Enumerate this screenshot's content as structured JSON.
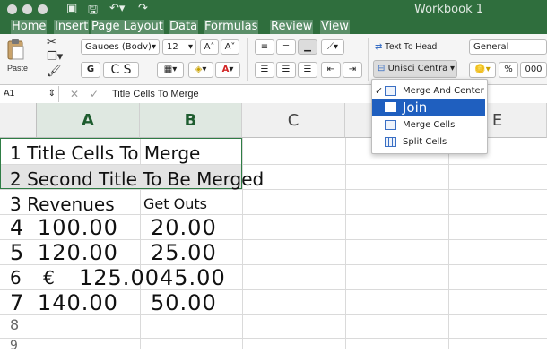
{
  "window": {
    "title": "Workbook 1",
    "controls": [
      "close-icon",
      "minimize-icon",
      "zoom-icon"
    ]
  },
  "quick_access": [
    "sidebar-icon",
    "save-icon",
    "undo-icon",
    "redo-icon"
  ],
  "menu": {
    "tabs": [
      "Home",
      "Insert",
      "Page Layout",
      "Data",
      "Formulas",
      "Review",
      "View"
    ]
  },
  "ribbon": {
    "paste_label": "Paste",
    "font_name": "Gauoes (Bodv)",
    "font_size": "12",
    "grow_font": "A",
    "shrink_font": "A",
    "bold": "G",
    "italic": "C",
    "underline": "S",
    "wrap_text": "Text To Head",
    "merge_selected": "Unisci Centra",
    "number_format": "General",
    "percent": "%",
    "comma": "000"
  },
  "formula_bar": {
    "cell_ref": "A1",
    "content": "Title Cells To Merge"
  },
  "columns": [
    "A",
    "B",
    "C",
    "D",
    "E"
  ],
  "rows": [
    {
      "num": "1",
      "a": "Title Cells To Merge"
    },
    {
      "num": "2",
      "a": "Second Title To Be Merged"
    },
    {
      "num": "3",
      "a": "Revenues",
      "b": "Get Outs"
    },
    {
      "num": "4",
      "a": "100.00",
      "b": "20.00"
    },
    {
      "num": "5",
      "a": "120.00",
      "b": "25.00"
    },
    {
      "num": "6",
      "currency": "€",
      "a": "125.00",
      "b": "45.00"
    },
    {
      "num": "7",
      "a": "140.00",
      "b": "50.00"
    },
    {
      "num": "8"
    },
    {
      "num": "9"
    }
  ],
  "merge_menu": {
    "items": [
      {
        "label": "Merge And Center",
        "checked": true,
        "icon": "merge-center-icon"
      },
      {
        "label": "Join",
        "highlighted": true,
        "icon": "merge-across-icon"
      },
      {
        "label": "Merge Cells",
        "icon": "merge-cells-icon"
      },
      {
        "label": "Split Cells",
        "icon": "split-cells-icon"
      }
    ]
  },
  "colors": {
    "title_bar": "#2f6e3d",
    "selection": "#1f5fbf",
    "accent": "#2f7d45"
  }
}
